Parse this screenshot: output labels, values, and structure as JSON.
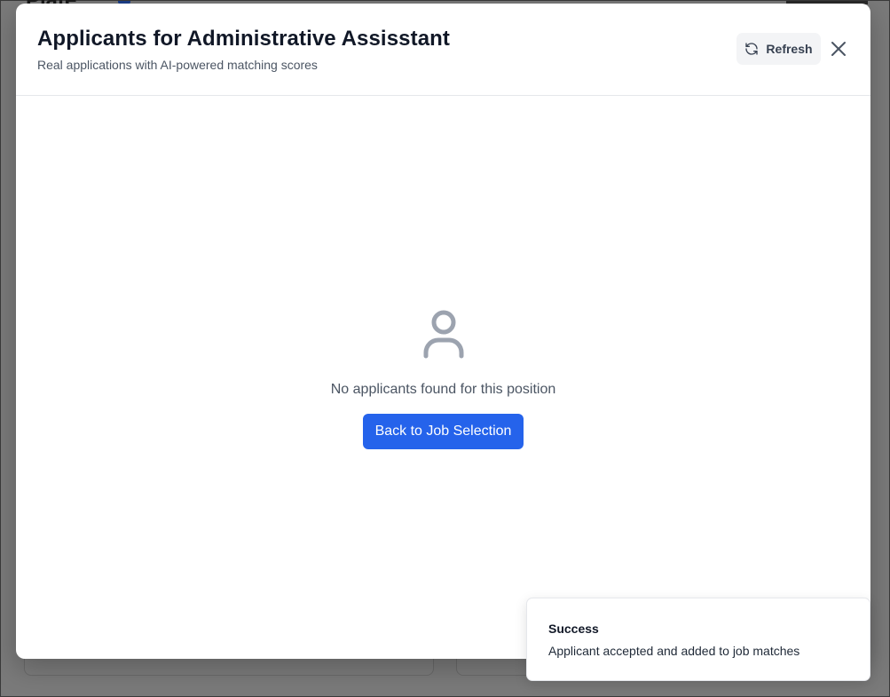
{
  "background": {
    "title": "Plate"
  },
  "modal": {
    "title": "Applicants for Administrative Assisstant",
    "subtitle": "Real applications with AI-powered matching scores",
    "refresh_label": "Refresh",
    "refresh_icon": "refresh-icon",
    "close_icon": "close-icon"
  },
  "empty_state": {
    "icon": "user-icon",
    "message": "No applicants found for this position",
    "button_label": "Back to Job Selection"
  },
  "toast": {
    "title": "Success",
    "message": "Applicant accepted and added to job matches"
  },
  "colors": {
    "primary": "#2563eb",
    "overlay": "#767676",
    "icon_gray": "#9ca3af"
  }
}
